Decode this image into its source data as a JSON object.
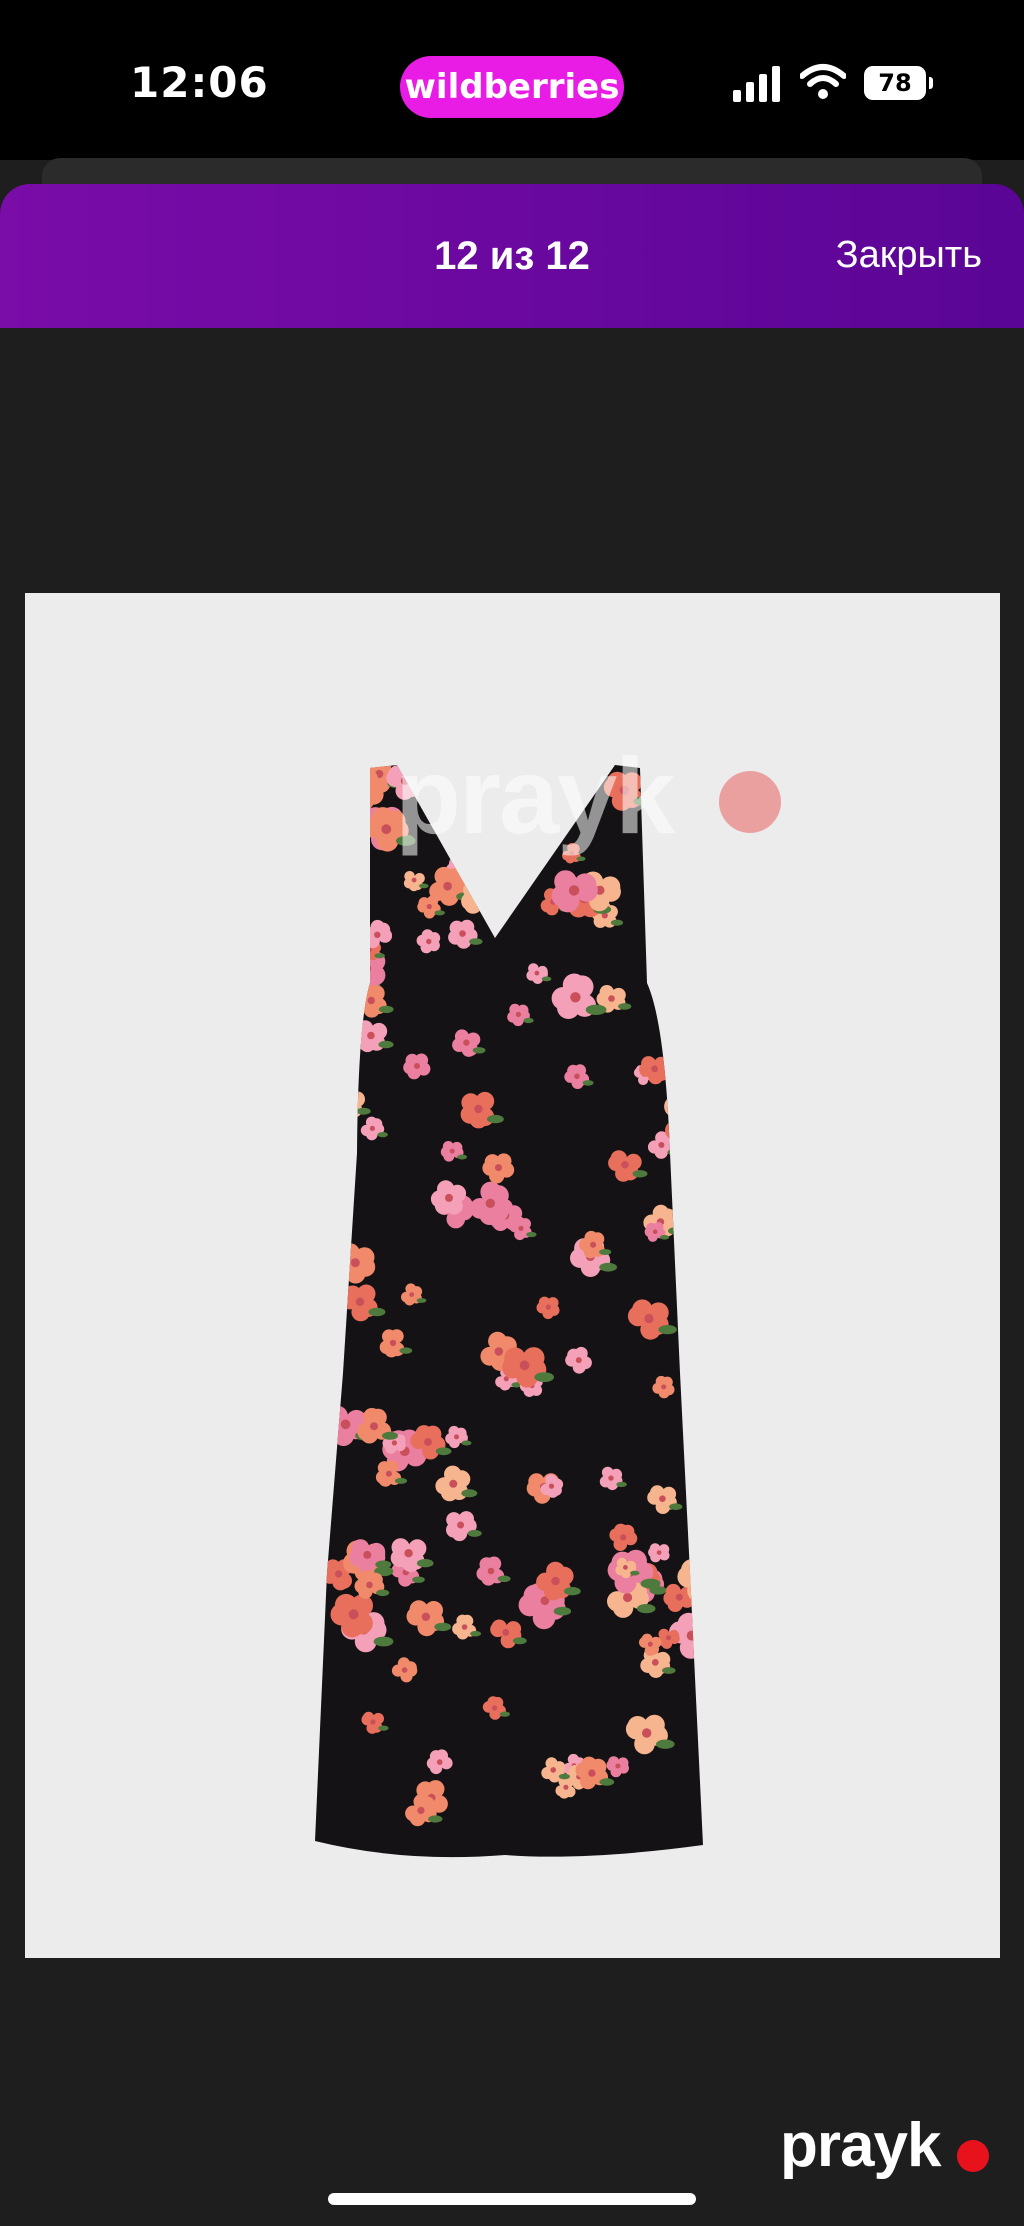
{
  "status_bar": {
    "time": "12:06",
    "app_name": "wildberries",
    "battery": "78"
  },
  "viewer": {
    "counter": "12 из 12",
    "close_label": "Закрыть"
  },
  "watermark": {
    "brand": "prayk"
  },
  "colors": {
    "header": "#6a089f",
    "app_pill": "#e91ce6",
    "background": "#1e1e1e"
  }
}
